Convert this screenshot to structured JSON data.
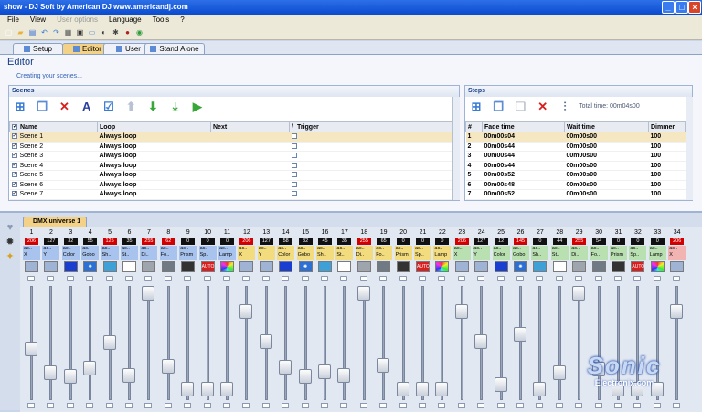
{
  "window": {
    "title": "show - DJ Soft    by American DJ    www.americandj.com"
  },
  "menu": [
    {
      "label": "File",
      "enabled": true
    },
    {
      "label": "View",
      "enabled": true
    },
    {
      "label": "User options",
      "enabled": false
    },
    {
      "label": "Language",
      "enabled": true
    },
    {
      "label": "Tools",
      "enabled": true
    },
    {
      "label": "?",
      "enabled": true
    }
  ],
  "toolbar_icons": [
    "new-icon",
    "open-icon",
    "save-icon",
    "undo-icon",
    "redo-icon",
    "fixture-icon",
    "dmx-icon",
    "window-icon",
    "blackout-icon",
    "gear-icon",
    "record-icon",
    "globe-icon"
  ],
  "tabs": [
    {
      "label": "Setup",
      "active": false
    },
    {
      "label": "Editor",
      "active": true
    },
    {
      "label": "User",
      "active": false
    },
    {
      "label": "Stand Alone",
      "active": false
    }
  ],
  "editor": {
    "title": "Editor",
    "subtitle": "Creating your scenes..."
  },
  "scenes": {
    "title": "Scenes",
    "headers": [
      "Name",
      "Loop",
      "Next",
      "Trigger"
    ],
    "rows": [
      {
        "name": "Scene 1",
        "loop": "Always loop",
        "selected": true
      },
      {
        "name": "Scene 2",
        "loop": "Always loop",
        "selected": false
      },
      {
        "name": "Scene 3",
        "loop": "Always loop",
        "selected": false
      },
      {
        "name": "Scene 4",
        "loop": "Always loop",
        "selected": false
      },
      {
        "name": "Scene 5",
        "loop": "Always loop",
        "selected": false
      },
      {
        "name": "Scene 6",
        "loop": "Always loop",
        "selected": false
      },
      {
        "name": "Scene 7",
        "loop": "Always loop",
        "selected": false
      }
    ]
  },
  "steps": {
    "title": "Steps",
    "total_time_label": "Total time: 00m04s00",
    "headers": [
      "#",
      "Fade time",
      "Wait time",
      "Dimmer"
    ],
    "rows": [
      {
        "n": "1",
        "fade": "00m00s04",
        "wait": "00m00s00",
        "dimmer": "100"
      },
      {
        "n": "2",
        "fade": "00m00s44",
        "wait": "00m00s00",
        "dimmer": "100"
      },
      {
        "n": "3",
        "fade": "00m00s44",
        "wait": "00m00s00",
        "dimmer": "100"
      },
      {
        "n": "4",
        "fade": "00m00s44",
        "wait": "00m00s00",
        "dimmer": "100"
      },
      {
        "n": "5",
        "fade": "00m00s52",
        "wait": "00m00s00",
        "dimmer": "100"
      },
      {
        "n": "6",
        "fade": "00m00s48",
        "wait": "00m00s00",
        "dimmer": "100"
      },
      {
        "n": "7",
        "fade": "00m00s52",
        "wait": "00m00s00",
        "dimmer": "100"
      }
    ]
  },
  "dmx": {
    "tab_label": "DMX universe 1",
    "channels": [
      {
        "n": "1",
        "v": "206",
        "red": true,
        "l1": "ac..",
        "l2": "X",
        "color": "#a8c4ee",
        "pic": "pan",
        "level": 0.42
      },
      {
        "n": "2",
        "v": "127",
        "red": false,
        "l1": "ac..",
        "l2": "Y",
        "color": "#a8c4ee",
        "pic": "tilt",
        "level": 0.17
      },
      {
        "n": "3",
        "v": "32",
        "red": false,
        "l1": "ac..",
        "l2": "Color",
        "color": "#a8c4ee",
        "pic": "color",
        "level": 0.13
      },
      {
        "n": "4",
        "v": "55",
        "red": false,
        "l1": "ac..",
        "l2": "Gobo",
        "color": "#a8c4ee",
        "pic": "gobo",
        "level": 0.22
      },
      {
        "n": "5",
        "v": "125",
        "red": true,
        "l1": "ac..",
        "l2": "Sh..",
        "color": "#a8c4ee",
        "pic": "shutter",
        "level": 0.49
      },
      {
        "n": "6",
        "v": "35",
        "red": false,
        "l1": "ac..",
        "l2": "St..",
        "color": "#a8c4ee",
        "pic": "strobe",
        "level": 0.14
      },
      {
        "n": "7",
        "v": "255",
        "red": true,
        "l1": "ac..",
        "l2": "Di..",
        "color": "#a8c4ee",
        "pic": "dimmer",
        "level": 1.0
      },
      {
        "n": "8",
        "v": "62",
        "red": true,
        "l1": "ac..",
        "l2": "Fo..",
        "color": "#a8c4ee",
        "pic": "focus",
        "level": 0.24
      },
      {
        "n": "9",
        "v": "0",
        "red": false,
        "l1": "ac..",
        "l2": "Prism",
        "color": "#a8c4ee",
        "pic": "prism",
        "level": 0.0
      },
      {
        "n": "10",
        "v": "0",
        "red": false,
        "l1": "ac..",
        "l2": "Sp..",
        "color": "#a8c4ee",
        "pic": "auto",
        "level": 0.0
      },
      {
        "n": "11",
        "v": "0",
        "red": false,
        "l1": "ac..",
        "l2": "Lamp",
        "color": "#a8c4ee",
        "pic": "lamp",
        "level": 0.0
      },
      {
        "n": "12",
        "v": "206",
        "red": true,
        "l1": "ac..",
        "l2": "X",
        "color": "#f3dc7e",
        "pic": "pan",
        "level": 0.81
      },
      {
        "n": "13",
        "v": "127",
        "red": false,
        "l1": "ac..",
        "l2": "Y",
        "color": "#f3dc7e",
        "pic": "tilt",
        "level": 0.5
      },
      {
        "n": "14",
        "v": "58",
        "red": false,
        "l1": "ac..",
        "l2": "Color",
        "color": "#f3dc7e",
        "pic": "color",
        "level": 0.23
      },
      {
        "n": "15",
        "v": "32",
        "red": false,
        "l1": "ac..",
        "l2": "Gobo",
        "color": "#f3dc7e",
        "pic": "gobo",
        "level": 0.13
      },
      {
        "n": "16",
        "v": "45",
        "red": false,
        "l1": "ac..",
        "l2": "Sh..",
        "color": "#f3dc7e",
        "pic": "shutter",
        "level": 0.18
      },
      {
        "n": "17",
        "v": "35",
        "red": false,
        "l1": "ac..",
        "l2": "St..",
        "color": "#f3dc7e",
        "pic": "strobe",
        "level": 0.14
      },
      {
        "n": "18",
        "v": "255",
        "red": true,
        "l1": "ac..",
        "l2": "Di..",
        "color": "#f3dc7e",
        "pic": "dimmer",
        "level": 1.0
      },
      {
        "n": "19",
        "v": "65",
        "red": false,
        "l1": "ac..",
        "l2": "Fo..",
        "color": "#f3dc7e",
        "pic": "focus",
        "level": 0.25
      },
      {
        "n": "20",
        "v": "0",
        "red": false,
        "l1": "ac..",
        "l2": "Prism",
        "color": "#f3dc7e",
        "pic": "prism",
        "level": 0.0
      },
      {
        "n": "21",
        "v": "0",
        "red": false,
        "l1": "ac..",
        "l2": "Sp..",
        "color": "#f3dc7e",
        "pic": "auto",
        "level": 0.0
      },
      {
        "n": "22",
        "v": "0",
        "red": false,
        "l1": "ac..",
        "l2": "Lamp",
        "color": "#f3dc7e",
        "pic": "lamp",
        "level": 0.0
      },
      {
        "n": "23",
        "v": "206",
        "red": true,
        "l1": "ac..",
        "l2": "X",
        "color": "#b9e0b1",
        "pic": "pan",
        "level": 0.81
      },
      {
        "n": "24",
        "v": "127",
        "red": false,
        "l1": "ac..",
        "l2": "Y",
        "color": "#b9e0b1",
        "pic": "tilt",
        "level": 0.5
      },
      {
        "n": "25",
        "v": "12",
        "red": false,
        "l1": "ac..",
        "l2": "Color",
        "color": "#b9e0b1",
        "pic": "color",
        "level": 0.05
      },
      {
        "n": "26",
        "v": "145",
        "red": true,
        "l1": "ac..",
        "l2": "Gobo",
        "color": "#b9e0b1",
        "pic": "gobo",
        "level": 0.57
      },
      {
        "n": "27",
        "v": "0",
        "red": false,
        "l1": "ac..",
        "l2": "Sh..",
        "color": "#b9e0b1",
        "pic": "shutter",
        "level": 0.0
      },
      {
        "n": "28",
        "v": "44",
        "red": false,
        "l1": "ac..",
        "l2": "St..",
        "color": "#b9e0b1",
        "pic": "strobe",
        "level": 0.17
      },
      {
        "n": "29",
        "v": "255",
        "red": true,
        "l1": "ac..",
        "l2": "Di..",
        "color": "#b9e0b1",
        "pic": "dimmer",
        "level": 1.0
      },
      {
        "n": "30",
        "v": "54",
        "red": false,
        "l1": "ac..",
        "l2": "Fo..",
        "color": "#b9e0b1",
        "pic": "focus",
        "level": 0.21
      },
      {
        "n": "31",
        "v": "0",
        "red": false,
        "l1": "ac..",
        "l2": "Prism",
        "color": "#b9e0b1",
        "pic": "prism",
        "level": 0.0
      },
      {
        "n": "32",
        "v": "0",
        "red": false,
        "l1": "ac..",
        "l2": "Sp..",
        "color": "#b9e0b1",
        "pic": "auto",
        "level": 0.0
      },
      {
        "n": "33",
        "v": "0",
        "red": false,
        "l1": "ac..",
        "l2": "Lamp",
        "color": "#b9e0b1",
        "pic": "lamp",
        "level": 0.0
      },
      {
        "n": "34",
        "v": "206",
        "red": true,
        "l1": "ac..",
        "l2": "X",
        "color": "#f2b3b3",
        "pic": "pan",
        "level": 0.81
      }
    ]
  },
  "watermark": {
    "line1": "Sonic",
    "line2": "Electronix.com"
  },
  "colors": {
    "title_bar": "#0b4bd0",
    "active_tab": "#f3d287",
    "selected_row": "#f5e7c1",
    "value_red": "#d20000"
  }
}
